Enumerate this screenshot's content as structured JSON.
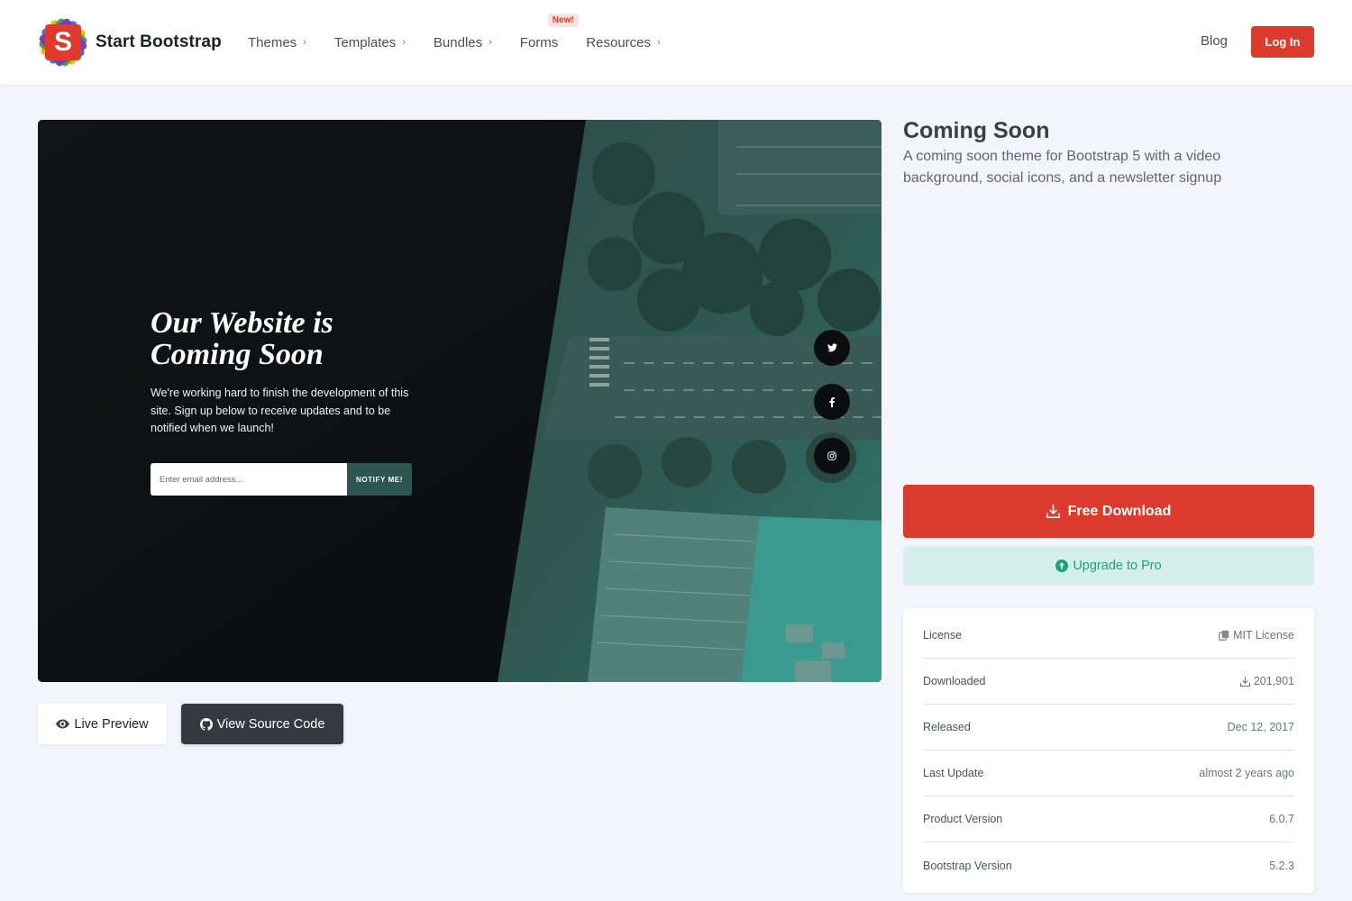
{
  "brand": {
    "name": "Start Bootstrap",
    "logo_letter": "S"
  },
  "nav": {
    "items": [
      {
        "label": "Themes"
      },
      {
        "label": "Templates"
      },
      {
        "label": "Bundles"
      },
      {
        "label": "Forms",
        "badge": "New!"
      },
      {
        "label": "Resources"
      }
    ],
    "blog": "Blog",
    "login": "Log In"
  },
  "preview": {
    "title": "Our Website is Coming Soon",
    "text": "We're working hard to finish the development of this site. Sign up below to receive updates and to be notified when we launch!",
    "input_placeholder": "Enter email address...",
    "notify_button": "NOTIFY ME!",
    "social_icons": [
      "twitter-icon",
      "facebook-icon",
      "instagram-icon"
    ]
  },
  "actions": {
    "live_preview": "Live Preview",
    "view_source": "View Source Code"
  },
  "product": {
    "title": "Coming Soon",
    "description": "A coming soon theme for Bootstrap 5 with a video background, social icons, and a newsletter signup",
    "free_download": "Free Download",
    "upgrade": "Upgrade to Pro"
  },
  "info": [
    {
      "label": "License",
      "value": "MIT License",
      "icon": "license-icon"
    },
    {
      "label": "Downloaded",
      "value": "201,901",
      "icon": "download-icon"
    },
    {
      "label": "Released",
      "value": "Dec 12, 2017"
    },
    {
      "label": "Last Update",
      "value": "almost 2 years ago"
    },
    {
      "label": "Product Version",
      "value": "6.0.7"
    },
    {
      "label": "Bootstrap Version",
      "value": "5.2.3"
    }
  ],
  "colors": {
    "brand_red": "#dd3b2e",
    "pro_bg": "#d7efeb",
    "pro_text": "#17a673",
    "preview_teal": "#2e5651",
    "page_bg": "#f3f5fb"
  }
}
